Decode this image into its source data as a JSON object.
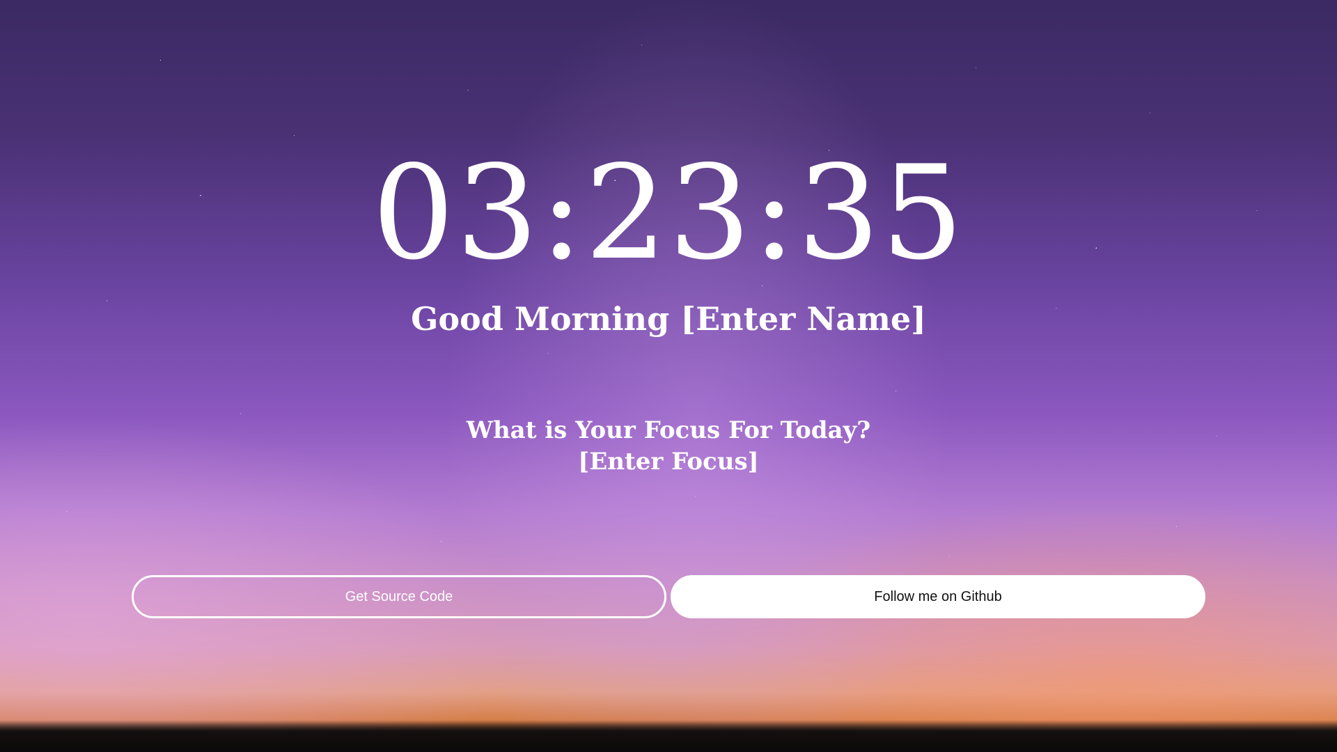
{
  "clock": {
    "time": "03:23:35"
  },
  "greeting": {
    "prefix": "Good Morning",
    "name": "[Enter Name]"
  },
  "focus": {
    "question": "What is Your Focus For Today?",
    "value": "[Enter Focus]"
  },
  "buttons": {
    "source_label": "Get Source Code",
    "github_label": "Follow me on Github"
  },
  "colors": {
    "text": "#ffffff",
    "github_button_bg": "#ffffff",
    "github_button_text": "#111111"
  }
}
